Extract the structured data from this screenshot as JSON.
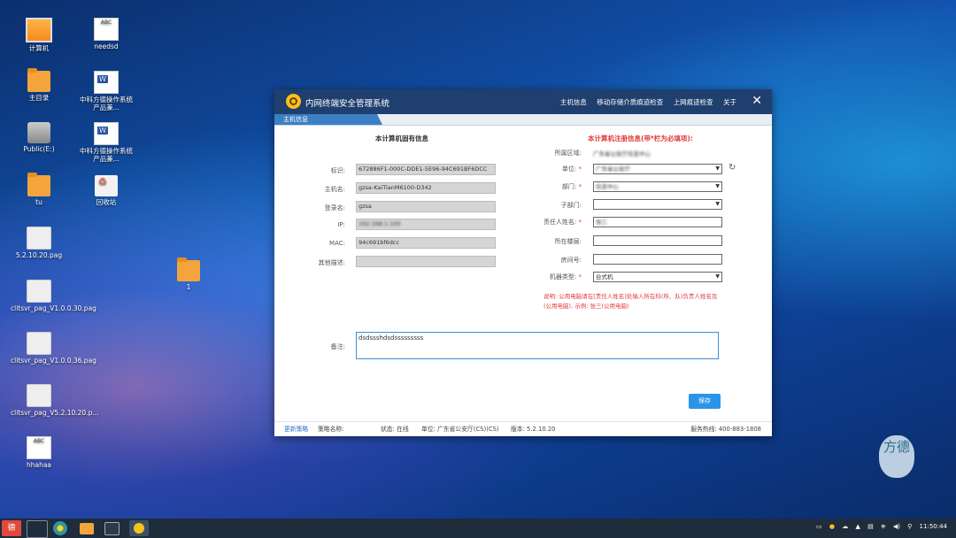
{
  "desktop_icons": [
    {
      "label": "计算机"
    },
    {
      "label": "needsd"
    },
    {
      "label": "主目录"
    },
    {
      "label": "中科方德操作系统产品兼..."
    },
    {
      "label": "Public(E:)"
    },
    {
      "label": "中科方德操作系统产品兼..."
    },
    {
      "label": "tu"
    },
    {
      "label": "回收站"
    },
    {
      "label": "5.2.10.20.pag"
    },
    {
      "label": "1"
    },
    {
      "label": "clitsvr_pag_V1.0.0.30.pag"
    },
    {
      "label": "clitsvr_pag_V1.0.0.36.pag"
    },
    {
      "label": "clitsvr_pag_V5.2.10.20.p..."
    },
    {
      "label": "hhahaa"
    }
  ],
  "icon_text": {
    "abc": "ABC"
  },
  "window": {
    "title": "内网终端安全管理系统",
    "menu": [
      "主机信息",
      "移动存储介质痕迹检查",
      "上网痕迹检查",
      "关于"
    ],
    "close": "✕",
    "tab": "主机信息"
  },
  "left_section": {
    "title": "本计算机固有信息",
    "fields": [
      {
        "label": "标识:",
        "value": "672886F1-000C-DDE1-5E96-94C691BF6DCC"
      },
      {
        "label": "主机名:",
        "value": "gzsa-KaiTianM6100-D342"
      },
      {
        "label": "登录名:",
        "value": "gzsa"
      },
      {
        "label": "IP:",
        "value": "192.168.1.100"
      },
      {
        "label": "MAC:",
        "value": "94c691bf6dcc"
      },
      {
        "label": "其他描述:",
        "value": ""
      }
    ]
  },
  "right_section": {
    "title": "本计算机注册信息(带*栏为必填项):",
    "area_label": "所属区域:",
    "area_value": "广东省公安厅信息中心",
    "fields": [
      {
        "label": "单位:",
        "required": "*",
        "value": "广东省公安厅"
      },
      {
        "label": "部门:",
        "required": "*",
        "value": "信息中心"
      },
      {
        "label": "子部门:",
        "required": "",
        "value": ""
      },
      {
        "label": "责任人姓名:",
        "required": "*",
        "value": "张三"
      },
      {
        "label": "所在楼层:",
        "required": "",
        "value": ""
      },
      {
        "label": "房间号:",
        "required": "",
        "value": ""
      },
      {
        "label": "机器类型:",
        "required": "*",
        "value": "台式机"
      }
    ],
    "refresh_icon": "↻",
    "note": "说明: 公用电脑请在[责任人姓名]处输入所在科(所、队)负责人姓名及(公用电脑), 示例: 张三(公用电脑)"
  },
  "remark": {
    "label": "备注:",
    "value": "dsdssshdsdsssssssss"
  },
  "save_label": "保存",
  "status": {
    "update_policy": "更新策略",
    "policy_name_label": "策略名称:",
    "state": "状态: 在线",
    "unit": "单位: 广东省公安厅(CS)(CS)",
    "version": "版本: 5.2.10.20",
    "hotline": "服务热线: 400-883-1808"
  },
  "taskbar": {
    "clock": "11:50:44",
    "start_label": "德"
  },
  "watermark": {
    "text": "方德"
  }
}
